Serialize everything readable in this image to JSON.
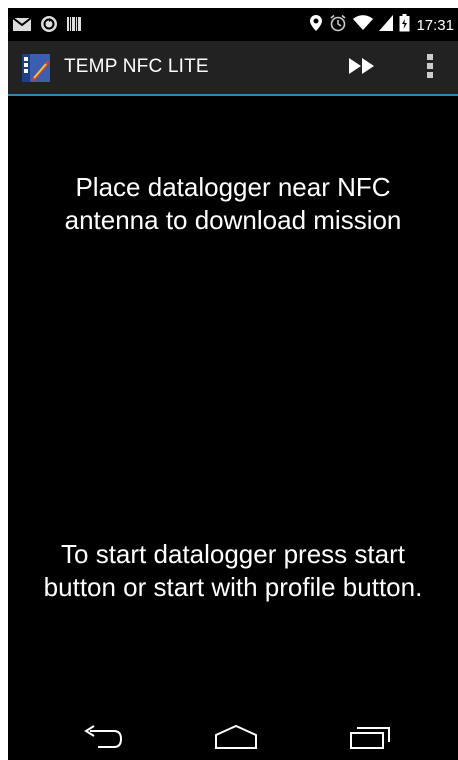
{
  "status_bar": {
    "time": "17:31",
    "left_icons": [
      "gmail-icon",
      "sync-icon",
      "barcode-icon"
    ],
    "right_icons": [
      "location-icon",
      "alarm-icon",
      "wifi-icon",
      "signal-icon",
      "battery-icon"
    ]
  },
  "action_bar": {
    "title": "TEMP NFC LITE",
    "icon": "tecno-app-icon",
    "actions": [
      "fast-forward-icon",
      "overflow-menu-icon"
    ]
  },
  "main": {
    "download_message": "Place datalogger near NFC antenna to download mission",
    "start_message": "To start datalogger press start button or start with profile button."
  },
  "nav_bar": {
    "buttons": [
      "back-icon",
      "home-icon",
      "recents-icon"
    ]
  },
  "colors": {
    "background": "#000000",
    "action_bar": "#222222",
    "accent": "#2f86b8",
    "text": "#ffffff"
  }
}
